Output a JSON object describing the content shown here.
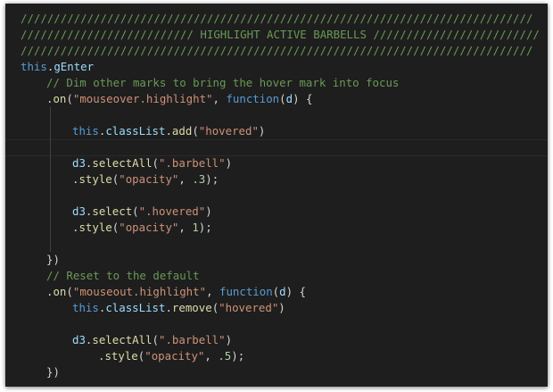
{
  "editor": {
    "theme_colors": {
      "background": "#1e1e1e",
      "comment": "#6a9955",
      "keyword": "#569cd6",
      "string": "#ce9178",
      "function": "#dcdcaa",
      "property": "#9cdcfe",
      "number": "#b5cea8",
      "text": "#d4d4d4"
    },
    "lines": [
      {
        "indent": 0,
        "tokens": [
          {
            "t": "/////////////////////////////////////////////////////////////////////////////",
            "c": "comment"
          }
        ]
      },
      {
        "indent": 0,
        "tokens": [
          {
            "t": "////////////////////////// HIGHLIGHT ACTIVE BARBELLS /////////////////////////",
            "c": "comment"
          }
        ]
      },
      {
        "indent": 0,
        "tokens": [
          {
            "t": "/////////////////////////////////////////////////////////////////////////////",
            "c": "comment"
          }
        ]
      },
      {
        "indent": 0,
        "tokens": [
          {
            "t": "this",
            "c": "kw"
          },
          {
            "t": ".",
            "c": "punct"
          },
          {
            "t": "gEnter",
            "c": "prop"
          }
        ]
      },
      {
        "indent": 1,
        "tokens": [
          {
            "t": "// Dim other marks to bring the hover mark into focus",
            "c": "comment"
          }
        ]
      },
      {
        "indent": 1,
        "tokens": [
          {
            "t": ".",
            "c": "punct"
          },
          {
            "t": "on",
            "c": "fn"
          },
          {
            "t": "(",
            "c": "punct"
          },
          {
            "t": "\"mouseover.highlight\"",
            "c": "str"
          },
          {
            "t": ", ",
            "c": "punct"
          },
          {
            "t": "function",
            "c": "kw"
          },
          {
            "t": "(",
            "c": "punct"
          },
          {
            "t": "d",
            "c": "prop"
          },
          {
            "t": ") {",
            "c": "punct"
          }
        ]
      },
      {
        "indent": 1,
        "guides": [
          1
        ],
        "tokens": []
      },
      {
        "indent": 2,
        "guides": [
          1
        ],
        "tokens": [
          {
            "t": "this",
            "c": "kw"
          },
          {
            "t": ".",
            "c": "punct"
          },
          {
            "t": "classList",
            "c": "prop"
          },
          {
            "t": ".",
            "c": "punct"
          },
          {
            "t": "add",
            "c": "fn"
          },
          {
            "t": "(",
            "c": "punct"
          },
          {
            "t": "\"hovered\"",
            "c": "str"
          },
          {
            "t": ")",
            "c": "punct"
          }
        ]
      },
      {
        "indent": 1,
        "guides": [
          1
        ],
        "current": true,
        "tokens": []
      },
      {
        "indent": 2,
        "guides": [
          1
        ],
        "tokens": [
          {
            "t": "d3",
            "c": "prop"
          },
          {
            "t": ".",
            "c": "punct"
          },
          {
            "t": "selectAll",
            "c": "fn"
          },
          {
            "t": "(",
            "c": "punct"
          },
          {
            "t": "\".barbell\"",
            "c": "str"
          },
          {
            "t": ")",
            "c": "punct"
          }
        ]
      },
      {
        "indent": 2,
        "guides": [
          1
        ],
        "tokens": [
          {
            "t": ".",
            "c": "punct"
          },
          {
            "t": "style",
            "c": "fn"
          },
          {
            "t": "(",
            "c": "punct"
          },
          {
            "t": "\"opacity\"",
            "c": "str"
          },
          {
            "t": ", ",
            "c": "punct"
          },
          {
            "t": ".3",
            "c": "num"
          },
          {
            "t": ");",
            "c": "punct"
          }
        ]
      },
      {
        "indent": 1,
        "guides": [
          1
        ],
        "tokens": []
      },
      {
        "indent": 2,
        "guides": [
          1
        ],
        "tokens": [
          {
            "t": "d3",
            "c": "prop"
          },
          {
            "t": ".",
            "c": "punct"
          },
          {
            "t": "select",
            "c": "fn"
          },
          {
            "t": "(",
            "c": "punct"
          },
          {
            "t": "\".hovered\"",
            "c": "str"
          },
          {
            "t": ")",
            "c": "punct"
          }
        ]
      },
      {
        "indent": 2,
        "guides": [
          1
        ],
        "tokens": [
          {
            "t": ".",
            "c": "punct"
          },
          {
            "t": "style",
            "c": "fn"
          },
          {
            "t": "(",
            "c": "punct"
          },
          {
            "t": "\"opacity\"",
            "c": "str"
          },
          {
            "t": ", ",
            "c": "punct"
          },
          {
            "t": "1",
            "c": "num"
          },
          {
            "t": ");",
            "c": "punct"
          }
        ]
      },
      {
        "indent": 1,
        "guides": [
          1
        ],
        "tokens": []
      },
      {
        "indent": 1,
        "tokens": [
          {
            "t": "})",
            "c": "punct"
          }
        ]
      },
      {
        "indent": 1,
        "tokens": [
          {
            "t": "// Reset to the default",
            "c": "comment"
          }
        ]
      },
      {
        "indent": 1,
        "tokens": [
          {
            "t": ".",
            "c": "punct"
          },
          {
            "t": "on",
            "c": "fn"
          },
          {
            "t": "(",
            "c": "punct"
          },
          {
            "t": "\"mouseout.highlight\"",
            "c": "str"
          },
          {
            "t": ", ",
            "c": "punct"
          },
          {
            "t": "function",
            "c": "kw"
          },
          {
            "t": "(",
            "c": "punct"
          },
          {
            "t": "d",
            "c": "prop"
          },
          {
            "t": ") {",
            "c": "punct"
          }
        ]
      },
      {
        "indent": 2,
        "tokens": [
          {
            "t": "this",
            "c": "kw"
          },
          {
            "t": ".",
            "c": "punct"
          },
          {
            "t": "classList",
            "c": "prop"
          },
          {
            "t": ".",
            "c": "punct"
          },
          {
            "t": "remove",
            "c": "fn"
          },
          {
            "t": "(",
            "c": "punct"
          },
          {
            "t": "\"hovered\"",
            "c": "str"
          },
          {
            "t": ")",
            "c": "punct"
          }
        ]
      },
      {
        "indent": 1,
        "tokens": []
      },
      {
        "indent": 2,
        "tokens": [
          {
            "t": "d3",
            "c": "prop"
          },
          {
            "t": ".",
            "c": "punct"
          },
          {
            "t": "selectAll",
            "c": "fn"
          },
          {
            "t": "(",
            "c": "punct"
          },
          {
            "t": "\".barbell\"",
            "c": "str"
          },
          {
            "t": ")",
            "c": "punct"
          }
        ]
      },
      {
        "indent": 3,
        "tokens": [
          {
            "t": ".",
            "c": "punct"
          },
          {
            "t": "style",
            "c": "fn"
          },
          {
            "t": "(",
            "c": "punct"
          },
          {
            "t": "\"opacity\"",
            "c": "str"
          },
          {
            "t": ", ",
            "c": "punct"
          },
          {
            "t": ".5",
            "c": "num"
          },
          {
            "t": ");",
            "c": "punct"
          }
        ]
      },
      {
        "indent": 1,
        "tokens": [
          {
            "t": "})",
            "c": "punct"
          }
        ]
      }
    ]
  }
}
